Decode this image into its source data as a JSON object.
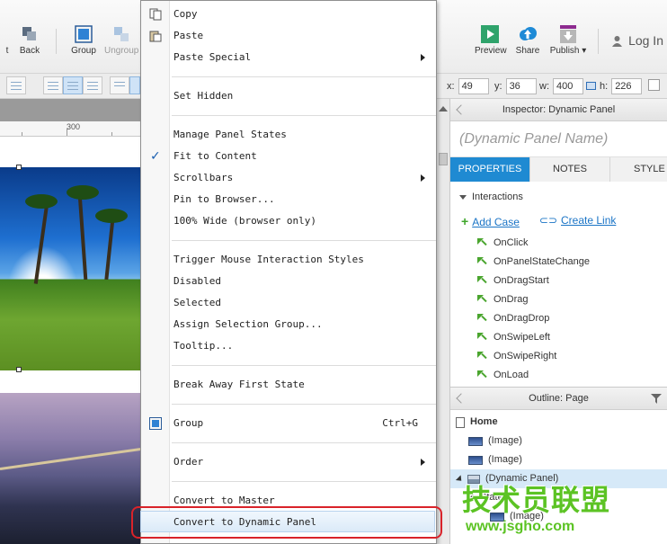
{
  "toolbar": {
    "items": [
      {
        "label": "t",
        "icon": "partial-icon"
      },
      {
        "label": "Back",
        "icon": "back-icon"
      },
      {
        "label": "Group",
        "icon": "group-icon"
      },
      {
        "label": "Ungroup",
        "icon": "ungroup-icon"
      },
      {
        "label": "Preview",
        "icon": "preview-icon"
      },
      {
        "label": "Share",
        "icon": "share-cloud-icon"
      },
      {
        "label": "Publish ▾",
        "icon": "publish-icon"
      }
    ],
    "login_label": "Log In"
  },
  "geometry": {
    "x_label": "x:",
    "x_value": "49",
    "y_label": "y:",
    "y_value": "36",
    "w_label": "w:",
    "w_value": "400",
    "h_label": "h:",
    "h_value": "226"
  },
  "canvas": {
    "ruler_label": "300"
  },
  "context_menu": {
    "items": [
      {
        "label": "Copy",
        "icon": "copy-icon"
      },
      {
        "label": "Paste",
        "icon": "paste-icon"
      },
      {
        "label": "Paste Special",
        "submenu": true
      },
      {
        "label": "Set Hidden"
      },
      {
        "label": "Manage Panel States"
      },
      {
        "label": "Fit to Content",
        "checked": true
      },
      {
        "label": "Scrollbars",
        "submenu": true
      },
      {
        "label": "Pin to Browser..."
      },
      {
        "label": "100% Wide (browser only)"
      },
      {
        "label": "Trigger Mouse Interaction Styles"
      },
      {
        "label": "Disabled"
      },
      {
        "label": "Selected"
      },
      {
        "label": "Assign Selection Group..."
      },
      {
        "label": "Tooltip..."
      },
      {
        "label": "Break Away First State"
      },
      {
        "label": "Group",
        "shortcut": "Ctrl+G",
        "icon": "group-icon"
      },
      {
        "label": "Order",
        "submenu": true
      },
      {
        "label": "Convert to Master"
      },
      {
        "label": "Convert to Dynamic Panel",
        "highlighted": true
      }
    ]
  },
  "inspector": {
    "title": "Inspector: Dynamic Panel",
    "name_placeholder": "(Dynamic Panel Name)",
    "tabs": [
      "PROPERTIES",
      "NOTES",
      "STYLE"
    ],
    "active_tab": "PROPERTIES",
    "section_title": "Interactions",
    "add_case": "Add Case",
    "create_link": "Create Link",
    "events": [
      "OnClick",
      "OnPanelStateChange",
      "OnDragStart",
      "OnDrag",
      "OnDragDrop",
      "OnSwipeLeft",
      "OnSwipeRight",
      "OnLoad"
    ]
  },
  "outline": {
    "title": "Outline: Page",
    "root": "Home",
    "items": [
      "(Image)",
      "(Image)",
      "(Dynamic Panel)",
      "State1",
      "(Image)"
    ]
  },
  "watermark": {
    "line1": "技术员联盟",
    "line2": "www.jsgho.com"
  },
  "colors": {
    "accent_tab": "#1f8ad2",
    "link": "#1a74c6",
    "event_green": "#4aa52e",
    "highlight_box": "#d9232a"
  }
}
